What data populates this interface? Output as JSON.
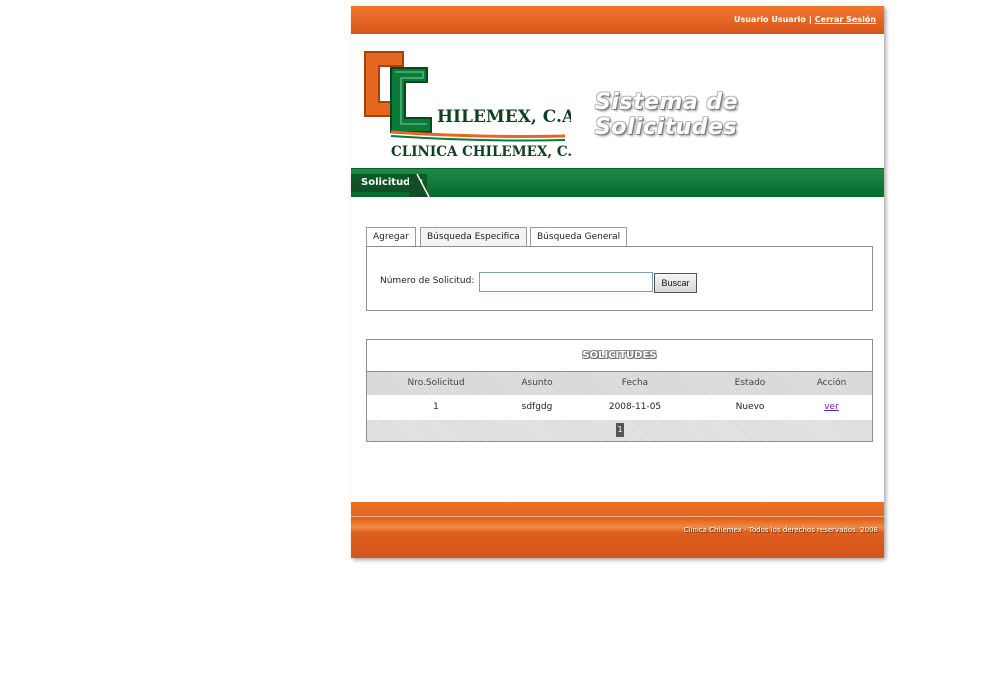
{
  "topbar": {
    "user_name": "Usuario Usuario",
    "separator": "|",
    "logout_label": "Cerrar Sesión"
  },
  "header": {
    "logo_line1": "HILEMEX, C.A.",
    "logo_line2": "CLINICA CHILEMEX, C.A.",
    "site_title": "Sistema de Solicitudes"
  },
  "nav": {
    "items": [
      {
        "label": "Solicitudes"
      }
    ]
  },
  "tabs": [
    {
      "label": "Agregar"
    },
    {
      "label": "Búsqueda Especifica"
    },
    {
      "label": "Búsqueda General"
    }
  ],
  "search": {
    "label": "Número de Solicitud:",
    "value": "",
    "button_label": "Buscar"
  },
  "results": {
    "title": "SOLICITUDES",
    "columns": [
      "Nro.Solicitud",
      "Asunto",
      "Fecha",
      "Estado",
      "Acción"
    ],
    "rows": [
      {
        "nro": "1",
        "asunto": "sdfgdg",
        "fecha": "2008-11-05",
        "estado": "Nuevo",
        "accion": "ver"
      }
    ],
    "pager": {
      "current": "1"
    }
  },
  "footer": {
    "text": "Clínica Chilemex - Todos los derechos reservados. 2008"
  },
  "colors": {
    "orange": "#e0621d",
    "green": "#046b2c",
    "link": "#6b1fa0"
  }
}
